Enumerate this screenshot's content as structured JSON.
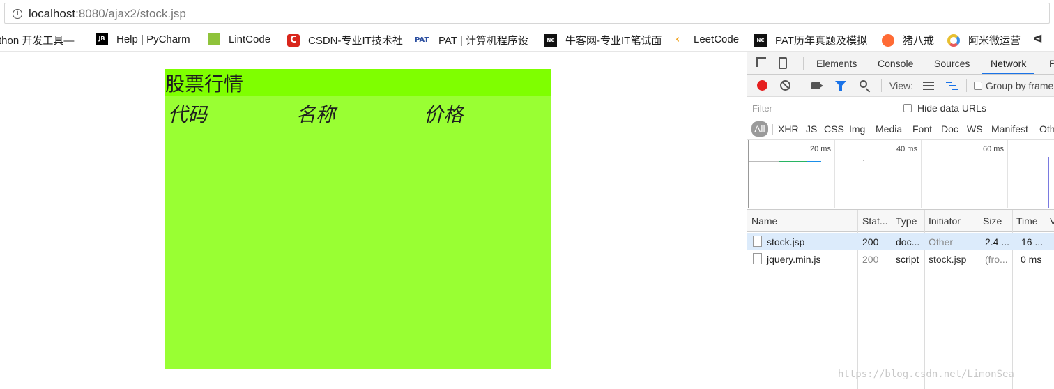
{
  "browser": {
    "url_host": "localhost",
    "url_rest": ":8080/ajax2/stock.jsp"
  },
  "bookmarks": [
    {
      "label": "thon 开发工具—",
      "icon": "none"
    },
    {
      "label": "Help | PyCharm",
      "icon": "jetbrains-icon"
    },
    {
      "label": "LintCode",
      "icon": "lintcode-icon"
    },
    {
      "label": "CSDN-专业IT技术社",
      "icon": "csdn-icon"
    },
    {
      "label": "PAT | 计算机程序设",
      "icon": "pat-icon"
    },
    {
      "label": "牛客网-专业IT笔试面",
      "icon": "nowcoder-icon"
    },
    {
      "label": "LeetCode",
      "icon": "leetcode-icon"
    },
    {
      "label": "PAT历年真题及模拟",
      "icon": "nowcoder-icon"
    },
    {
      "label": "猪八戒",
      "icon": "zbj-icon"
    },
    {
      "label": "阿米微运营",
      "icon": "amiwei-icon"
    }
  ],
  "page": {
    "title": "股票行情",
    "headers": [
      "代码",
      "名称",
      "价格"
    ],
    "colors": {
      "title_bg": "#7fff00",
      "body_bg": "#99ff33"
    }
  },
  "devtools": {
    "tabs": [
      "Elements",
      "Console",
      "Sources",
      "Network",
      "P"
    ],
    "active_tab": "Network",
    "toolbar": {
      "view_label": "View:",
      "group_label": "Group by frame"
    },
    "filter": {
      "placeholder": "Filter",
      "hide_data_urls": "Hide data URLs"
    },
    "types": [
      "All",
      "XHR",
      "JS",
      "CSS",
      "Img",
      "Media",
      "Font",
      "Doc",
      "WS",
      "Manifest",
      "Oth"
    ],
    "timeline_ticks": [
      "20 ms",
      "40 ms",
      "60 ms"
    ],
    "columns": [
      "Name",
      "Stat...",
      "Type",
      "Initiator",
      "Size",
      "Time",
      "V"
    ],
    "rows": [
      {
        "name": "stock.jsp",
        "status": "200",
        "type": "doc...",
        "initiator": "Other",
        "size": "2.4 ...",
        "time": "16 ..."
      },
      {
        "name": "jquery.min.js",
        "status": "200",
        "type": "script",
        "initiator": "stock.jsp",
        "size": "(fro...",
        "time": "0 ms"
      }
    ]
  },
  "watermark": "https://blog.csdn.net/LimonSea"
}
